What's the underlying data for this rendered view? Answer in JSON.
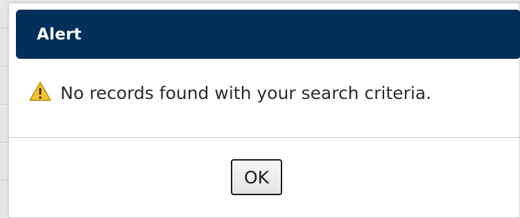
{
  "dialog": {
    "title": "Alert",
    "message": "No records found with your search criteria.",
    "icon": "warning-icon",
    "ok_label": "OK"
  },
  "colors": {
    "titlebar": "#03305a",
    "warning": "#f2c230"
  }
}
